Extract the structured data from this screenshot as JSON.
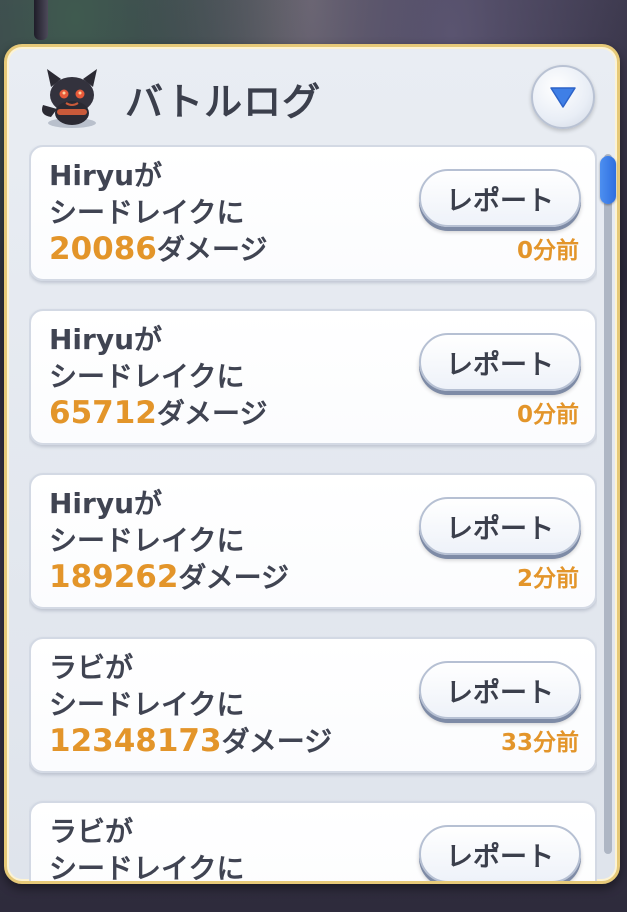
{
  "header": {
    "title": "バトルログ",
    "mascot_icon": "black-cat-mascot-icon",
    "collapse_icon": "triangle-down-icon"
  },
  "colors": {
    "accent_orange": "#e3952a",
    "scroll_blue": "#2f6fe0",
    "frame_gold": "#e6c978"
  },
  "log_entries": [
    {
      "line1": "Hiryuが",
      "line2": "シードレイクに",
      "damage": "20086",
      "damage_suffix": "ダメージ",
      "report_label": "レポート",
      "time_ago": "0分前"
    },
    {
      "line1": "Hiryuが",
      "line2": "シードレイクに",
      "damage": "65712",
      "damage_suffix": "ダメージ",
      "report_label": "レポート",
      "time_ago": "0分前"
    },
    {
      "line1": "Hiryuが",
      "line2": "シードレイクに",
      "damage": "189262",
      "damage_suffix": "ダメージ",
      "report_label": "レポート",
      "time_ago": "2分前"
    },
    {
      "line1": "ラビが",
      "line2": "シードレイクに",
      "damage": "12348173",
      "damage_suffix": "ダメージ",
      "report_label": "レポート",
      "time_ago": "33分前"
    },
    {
      "line1": "ラビが",
      "line2": "シードレイクに",
      "damage": "",
      "damage_suffix": "",
      "report_label": "レポート",
      "time_ago": ""
    }
  ]
}
